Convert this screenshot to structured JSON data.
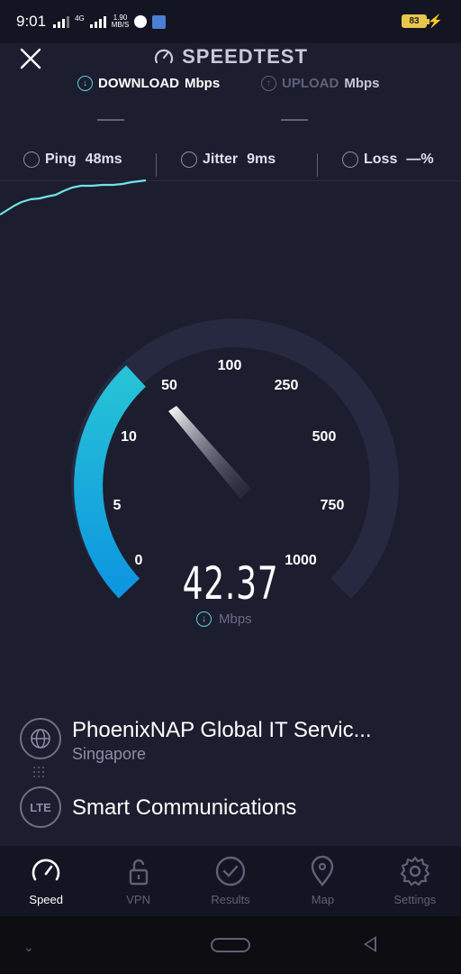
{
  "status_bar": {
    "time": "9:01",
    "network_type": "4G",
    "net_speed_value": "1.90",
    "net_speed_unit": "MB/S",
    "battery": "83"
  },
  "header": {
    "title": "SPEEDTEST",
    "close_icon": "close-icon"
  },
  "modes": {
    "download_label": "DOWNLOAD",
    "download_unit": "Mbps",
    "upload_label": "UPLOAD",
    "upload_unit": "Mbps"
  },
  "metrics": {
    "ping_label": "Ping",
    "ping_value": "48ms",
    "jitter_label": "Jitter",
    "jitter_value": "9ms",
    "loss_label": "Loss",
    "loss_value": "—%"
  },
  "gauge": {
    "ticks": [
      "0",
      "5",
      "10",
      "50",
      "100",
      "250",
      "500",
      "750",
      "1000"
    ],
    "current_speed": "42.37",
    "unit": "Mbps",
    "accent_color": "#1eb3da"
  },
  "server": {
    "name": "PhoenixNAP Global IT Servic...",
    "location": "Singapore"
  },
  "isp": {
    "badge": "LTE",
    "name": "Smart Communications"
  },
  "tabs": [
    {
      "label": "Speed",
      "icon": "speedometer-icon",
      "active": true
    },
    {
      "label": "VPN",
      "icon": "unlock-icon",
      "active": false
    },
    {
      "label": "Results",
      "icon": "check-circle-icon",
      "active": false
    },
    {
      "label": "Map",
      "icon": "map-pin-icon",
      "active": false
    },
    {
      "label": "Settings",
      "icon": "gear-icon",
      "active": false
    }
  ]
}
